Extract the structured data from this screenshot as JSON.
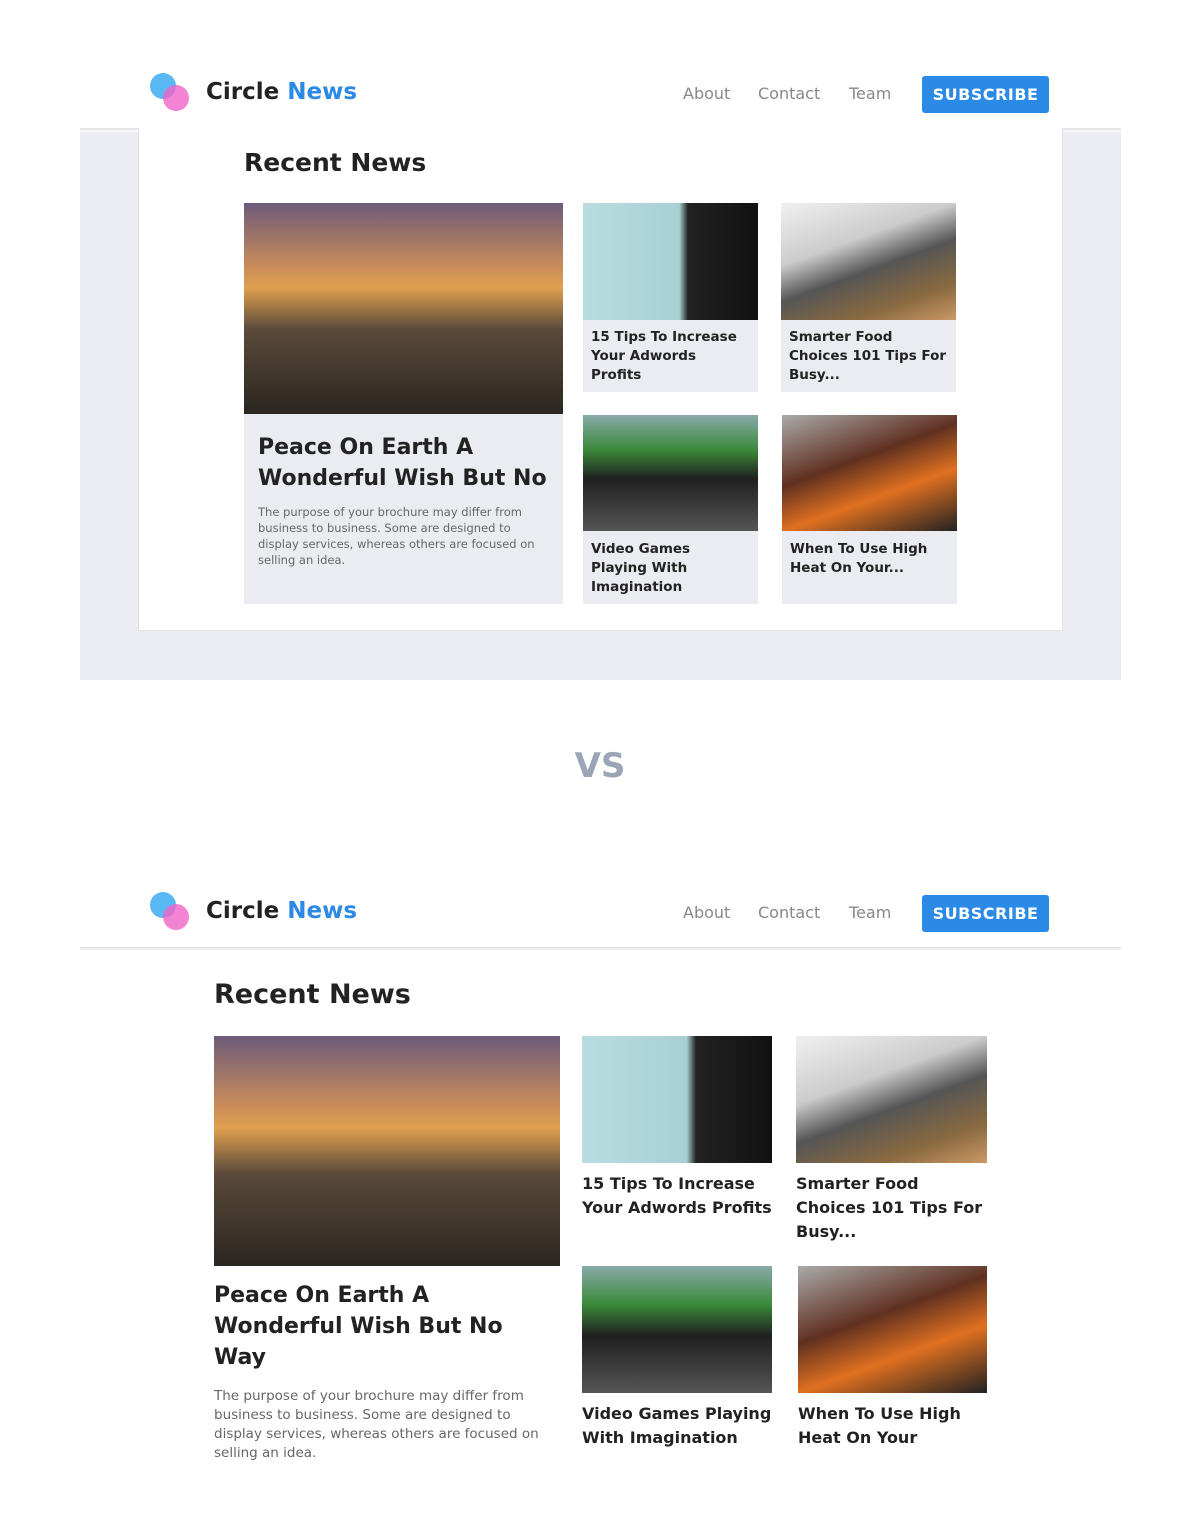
{
  "brand": {
    "word1": "Circle",
    "word2": "News"
  },
  "nav": {
    "items": [
      "About",
      "Contact",
      "Team"
    ],
    "subscribe": "SUBSCRIBE"
  },
  "section_title": "Recent News",
  "separator": "VS",
  "top": {
    "featured": {
      "title": "Peace On Earth A Wonderful Wish But No",
      "desc": "The purpose of your brochure may differ from business to business. Some are designed to display services, whereas others are focused on selling an idea."
    },
    "cards": [
      "15 Tips To Increase Your Adwords Profits",
      "Smarter Food Choices 101 Tips For Busy...",
      "Video Games Playing With Imagination",
      "When To Use High Heat On Your..."
    ]
  },
  "bottom": {
    "featured": {
      "title": "Peace On Earth A Wonderful Wish But No Way",
      "desc": "The purpose of your brochure may differ from business to business. Some are designed to display services, whereas others are focused on selling an idea."
    },
    "cards": [
      "15 Tips To Increase Your Adwords Profits",
      "Smarter Food Choices 101 Tips For Busy...",
      "Video Games Playing With Imagination",
      "When To Use High Heat On Your"
    ]
  },
  "colors": {
    "accent": "#2a8ae6",
    "panel": "#ecedf2",
    "vs": "#9aa5b8"
  }
}
